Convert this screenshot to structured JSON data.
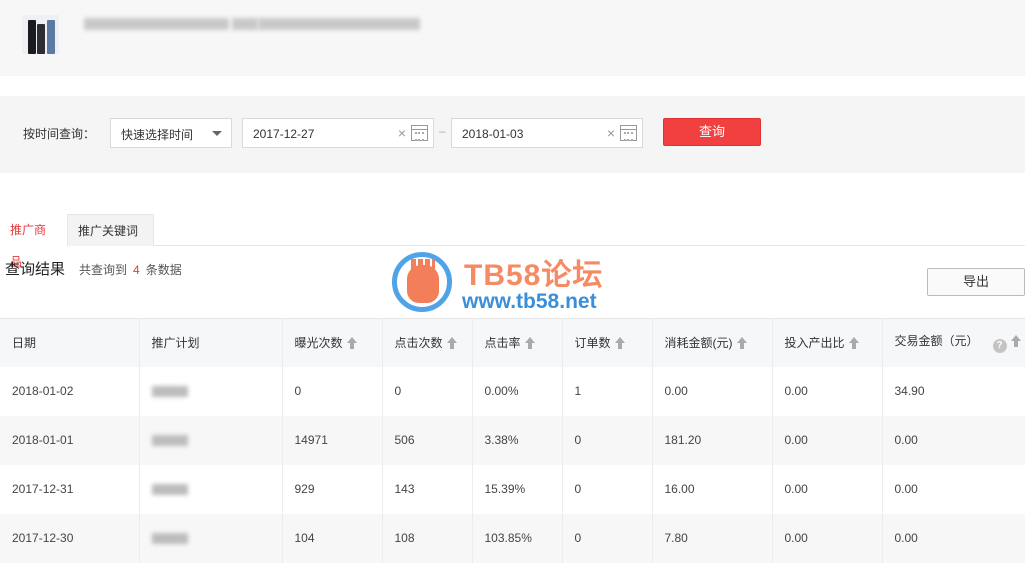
{
  "filter": {
    "label": "按时间查询：",
    "quick_select": "快速选择时间",
    "start_date": "2017-12-27",
    "end_date": "2018-01-03",
    "separator": "–",
    "query_button": "查询",
    "clear_symbol": "×"
  },
  "tabs": [
    {
      "label": "推广商品",
      "active": true
    },
    {
      "label": "推广关键词",
      "active": false
    }
  ],
  "result": {
    "title": "查询结果",
    "prefix": "共查询到",
    "count": "4",
    "suffix": "条数据",
    "export_button": "导出"
  },
  "watermark": {
    "title": "TB58论坛",
    "url": "www.tb58.net"
  },
  "table": {
    "headers": [
      "日期",
      "推广计划",
      "曝光次数",
      "点击次数",
      "点击率",
      "订单数",
      "消耗金额(元)",
      "投入产出比",
      "交易金额（元）"
    ],
    "rows": [
      [
        "2018-01-02",
        "",
        "0",
        "0",
        "0.00%",
        "1",
        "0.00",
        "0.00",
        "34.90"
      ],
      [
        "2018-01-01",
        "",
        "14971",
        "506",
        "3.38%",
        "0",
        "181.20",
        "0.00",
        "0.00"
      ],
      [
        "2017-12-31",
        "",
        "929",
        "143",
        "15.39%",
        "0",
        "16.00",
        "0.00",
        "0.00"
      ],
      [
        "2017-12-30",
        "",
        "104",
        "108",
        "103.85%",
        "0",
        "7.80",
        "0.00",
        "0.00"
      ]
    ]
  },
  "colors": {
    "accent_red": "#f23f3f",
    "tab_active": "#e4393c",
    "watermark_orange": "#f58a63",
    "watermark_blue": "#3b8fd9"
  },
  "icons": {
    "calendar": "calendar-icon",
    "sort": "sort-up-icon",
    "help": "question-mark-icon",
    "dropdown": "chevron-down-icon"
  }
}
